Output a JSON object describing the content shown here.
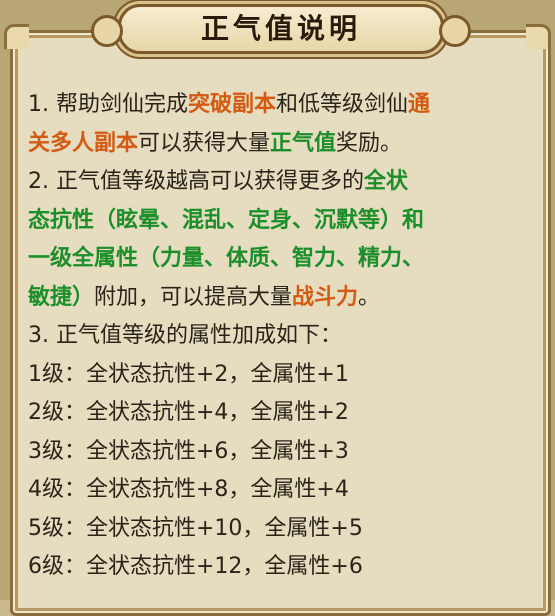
{
  "title": "正气值说明",
  "item1": {
    "prefix": "1. 帮助剑仙完成",
    "link1": "突破副本",
    "mid": "和低等级剑仙",
    "link2a": "通",
    "link2b": "关多人副本",
    "suffix": "可以获得大量",
    "reward": "正气值",
    "end": "奖励。"
  },
  "item2": {
    "prefix": "2.  正气值等级越高可以获得更多的",
    "attr1a": "全状",
    "attr1b": "态抗性",
    "paren1": "（眩晕、混乱、定身、沉默等）和",
    "attr2": "一级全属性",
    "paren2": "（力量、体质、智力、精力、",
    "paren2b": "敏捷）",
    "mid": "附加，可以提高大量",
    "power": "战斗力",
    "end": "。"
  },
  "item3": "3.   正气值等级的属性加成如下：",
  "levels": [
    "1级：全状态抗性+2，全属性+1",
    "2级：全状态抗性+4，全属性+2",
    "3级：全状态抗性+6，全属性+3",
    "4级：全状态抗性+8，全属性+4",
    "5级：全状态抗性+10，全属性+5",
    "6级：全状态抗性+12，全属性+6"
  ]
}
